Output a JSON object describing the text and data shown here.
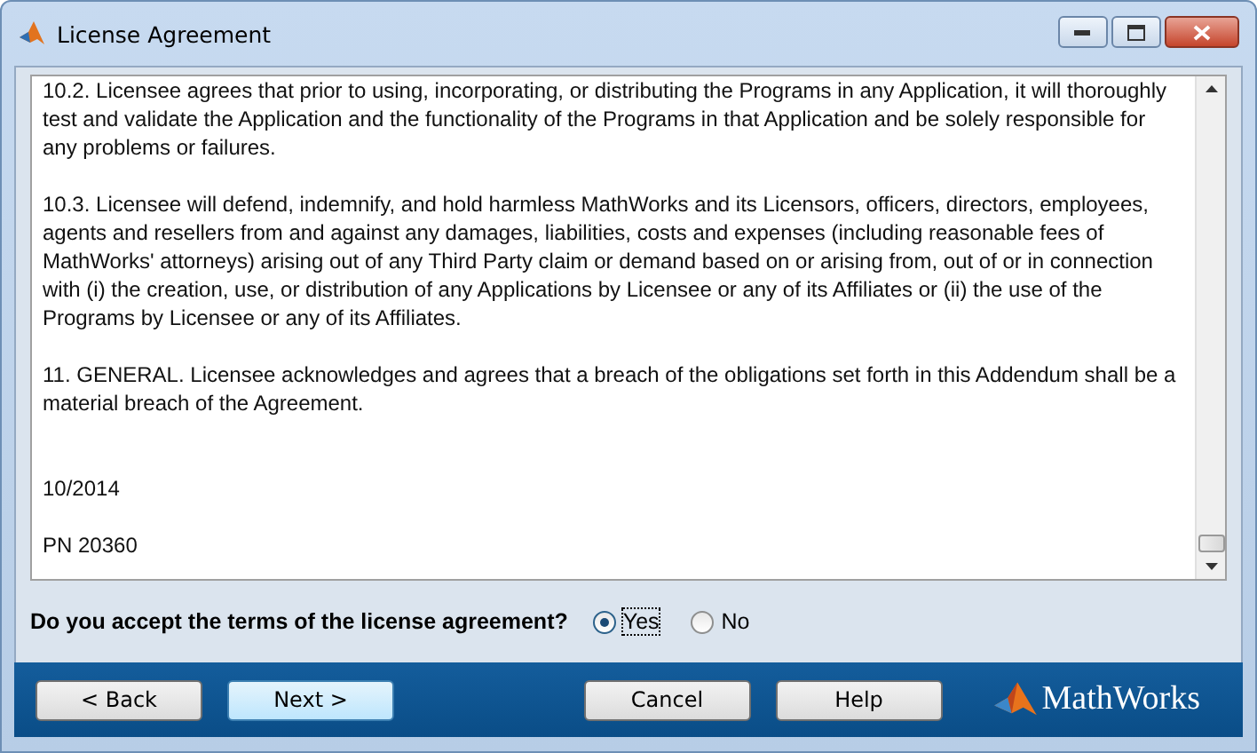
{
  "window": {
    "title": "License Agreement"
  },
  "license_text": [
    "10.2. Licensee agrees that prior to using, incorporating, or distributing the Programs in any Application, it will thoroughly test and validate the Application and the functionality of the Programs in that Application and be solely responsible for any problems or failures.",
    "10.3. Licensee will defend, indemnify, and hold harmless MathWorks and its Licensors, officers, directors, employees, agents and resellers from and against any damages, liabilities, costs and expenses (including reasonable fees of MathWorks' attorneys) arising out of any Third Party claim or demand based on or arising from, out of or in connection with (i) the creation, use, or distribution of any Applications by Licensee or any of its Affiliates or (ii) the use of the Programs by Licensee or any of its Affiliates.",
    "11. GENERAL. Licensee acknowledges and agrees that a breach of the obligations set forth in this Addendum shall be a material breach of the Agreement.",
    "10/2014",
    "PN 20360"
  ],
  "question": "Do you accept the terms of the license agreement?",
  "options": [
    {
      "label": "Yes",
      "selected": true
    },
    {
      "label": "No",
      "selected": false
    }
  ],
  "buttons": [
    {
      "label": "< Back",
      "default": false
    },
    {
      "label": "Next >",
      "default": true
    },
    {
      "label": "Cancel",
      "default": false
    },
    {
      "label": "Help",
      "default": false
    }
  ],
  "logo": {
    "text": "MathWorks"
  }
}
